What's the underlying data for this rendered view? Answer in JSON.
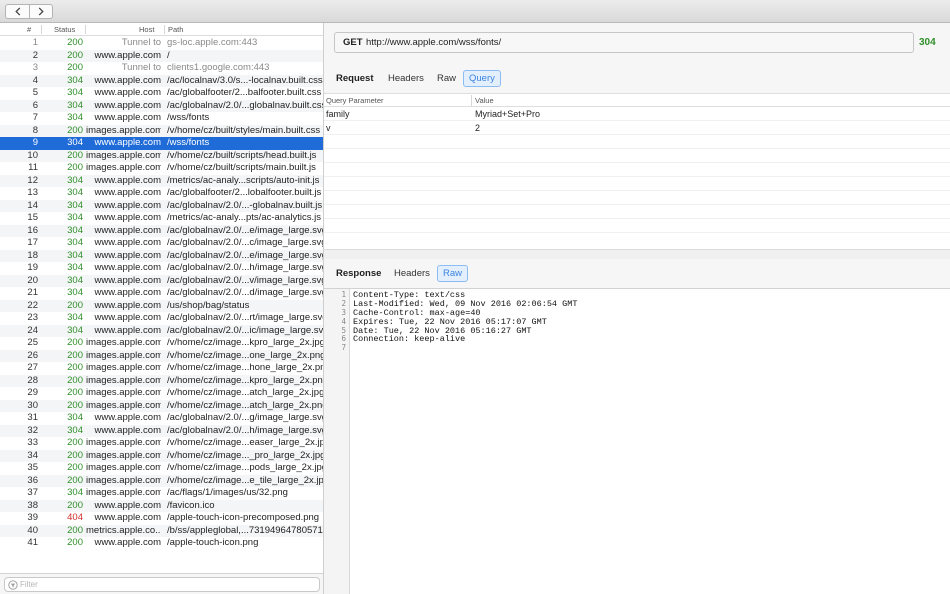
{
  "toolbar": {
    "back_icon": "chevron-left-icon",
    "forward_icon": "chevron-right-icon"
  },
  "list": {
    "headers": {
      "num": "#",
      "status": "Status",
      "host": "Host",
      "path": "Path"
    },
    "rows": [
      {
        "num": "1",
        "status": "200",
        "host": "Tunnel to",
        "path": "gs-loc.apple.com:443",
        "tunnel": true
      },
      {
        "num": "2",
        "status": "200",
        "host": "www.apple.com",
        "path": "/"
      },
      {
        "num": "3",
        "status": "200",
        "host": "Tunnel to",
        "path": "clients1.google.com:443",
        "tunnel": true
      },
      {
        "num": "4",
        "status": "304",
        "host": "www.apple.com",
        "path": "/ac/localnav/3.0/s...-localnav.built.css"
      },
      {
        "num": "5",
        "status": "304",
        "host": "www.apple.com",
        "path": "/ac/globalfooter/2...balfooter.built.css"
      },
      {
        "num": "6",
        "status": "304",
        "host": "www.apple.com",
        "path": "/ac/globalnav/2.0/...globalnav.built.css"
      },
      {
        "num": "7",
        "status": "304",
        "host": "www.apple.com",
        "path": "/wss/fonts"
      },
      {
        "num": "8",
        "status": "200",
        "host": "images.apple.com",
        "path": "/v/home/cz/built/styles/main.built.css"
      },
      {
        "num": "9",
        "status": "304",
        "host": "www.apple.com",
        "path": "/wss/fonts",
        "selected": true
      },
      {
        "num": "10",
        "status": "200",
        "host": "images.apple.com",
        "path": "/v/home/cz/built/scripts/head.built.js"
      },
      {
        "num": "11",
        "status": "200",
        "host": "images.apple.com",
        "path": "/v/home/cz/built/scripts/main.built.js"
      },
      {
        "num": "12",
        "status": "304",
        "host": "www.apple.com",
        "path": "/metrics/ac-analy...scripts/auto-init.js"
      },
      {
        "num": "13",
        "status": "304",
        "host": "www.apple.com",
        "path": "/ac/globalfooter/2...lobalfooter.built.js"
      },
      {
        "num": "14",
        "status": "304",
        "host": "www.apple.com",
        "path": "/ac/globalnav/2.0/...-globalnav.built.js"
      },
      {
        "num": "15",
        "status": "304",
        "host": "www.apple.com",
        "path": "/metrics/ac-analy...pts/ac-analytics.js"
      },
      {
        "num": "16",
        "status": "304",
        "host": "www.apple.com",
        "path": "/ac/globalnav/2.0/...e/image_large.svg"
      },
      {
        "num": "17",
        "status": "304",
        "host": "www.apple.com",
        "path": "/ac/globalnav/2.0/...c/image_large.svg"
      },
      {
        "num": "18",
        "status": "304",
        "host": "www.apple.com",
        "path": "/ac/globalnav/2.0/...e/image_large.svg"
      },
      {
        "num": "19",
        "status": "304",
        "host": "www.apple.com",
        "path": "/ac/globalnav/2.0/...h/image_large.svg"
      },
      {
        "num": "20",
        "status": "304",
        "host": "www.apple.com",
        "path": "/ac/globalnav/2.0/...v/image_large.svg"
      },
      {
        "num": "21",
        "status": "304",
        "host": "www.apple.com",
        "path": "/ac/globalnav/2.0/...d/image_large.svg"
      },
      {
        "num": "22",
        "status": "200",
        "host": "www.apple.com",
        "path": "/us/shop/bag/status"
      },
      {
        "num": "23",
        "status": "304",
        "host": "www.apple.com",
        "path": "/ac/globalnav/2.0/...rt/image_large.svg"
      },
      {
        "num": "24",
        "status": "304",
        "host": "www.apple.com",
        "path": "/ac/globalnav/2.0/...ic/image_large.svg"
      },
      {
        "num": "25",
        "status": "200",
        "host": "images.apple.com",
        "path": "/v/home/cz/image...kpro_large_2x.jpg"
      },
      {
        "num": "26",
        "status": "200",
        "host": "images.apple.com",
        "path": "/v/home/cz/image...one_large_2x.png"
      },
      {
        "num": "27",
        "status": "200",
        "host": "images.apple.com",
        "path": "/v/home/cz/image...hone_large_2x.png"
      },
      {
        "num": "28",
        "status": "200",
        "host": "images.apple.com",
        "path": "/v/home/cz/image...kpro_large_2x.png"
      },
      {
        "num": "29",
        "status": "200",
        "host": "images.apple.com",
        "path": "/v/home/cz/image...atch_large_2x.jpg"
      },
      {
        "num": "30",
        "status": "200",
        "host": "images.apple.com",
        "path": "/v/home/cz/image...atch_large_2x.png"
      },
      {
        "num": "31",
        "status": "304",
        "host": "www.apple.com",
        "path": "/ac/globalnav/2.0/...g/image_large.svg"
      },
      {
        "num": "32",
        "status": "304",
        "host": "www.apple.com",
        "path": "/ac/globalnav/2.0/...h/image_large.svg"
      },
      {
        "num": "33",
        "status": "200",
        "host": "images.apple.com",
        "path": "/v/home/cz/image...easer_large_2x.jpg"
      },
      {
        "num": "34",
        "status": "200",
        "host": "images.apple.com",
        "path": "/v/home/cz/image..._pro_large_2x.jpg"
      },
      {
        "num": "35",
        "status": "200",
        "host": "images.apple.com",
        "path": "/v/home/cz/image...pods_large_2x.jpg"
      },
      {
        "num": "36",
        "status": "200",
        "host": "images.apple.com",
        "path": "/v/home/cz/image...e_tile_large_2x.jpg"
      },
      {
        "num": "37",
        "status": "304",
        "host": "images.apple.com",
        "path": "/ac/flags/1/images/us/32.png"
      },
      {
        "num": "38",
        "status": "200",
        "host": "www.apple.com",
        "path": "/favicon.ico"
      },
      {
        "num": "39",
        "status": "404",
        "host": "www.apple.com",
        "path": "/apple-touch-icon-precomposed.png"
      },
      {
        "num": "40",
        "status": "200",
        "host": "metrics.apple.co...",
        "path": "/b/ss/appleglobal,...73194964780571"
      },
      {
        "num": "41",
        "status": "200",
        "host": "www.apple.com",
        "path": "/apple-touch-icon.png"
      }
    ],
    "filter_placeholder": "Filter",
    "filter_icon": "filter-icon"
  },
  "request": {
    "method": "GET",
    "url": "http://www.apple.com/wss/fonts/",
    "status_code": "304",
    "section_title": "Request",
    "tabs": [
      "Headers",
      "Raw",
      "Query"
    ],
    "active_tab": "Query",
    "query_headers": {
      "param": "Query Parameter",
      "value": "Value"
    },
    "query_rows": [
      {
        "param": "family",
        "value": "Myriad+Set+Pro"
      },
      {
        "param": "v",
        "value": "2"
      }
    ]
  },
  "response": {
    "section_title": "Response",
    "tabs": [
      "Headers",
      "Raw"
    ],
    "active_tab": "Raw",
    "raw_lines": [
      "Content-Type: text/css",
      "Last-Modified: Wed, 09 Nov 2016 02:06:54 GMT",
      "Cache-Control: max-age=40",
      "Expires: Tue, 22 Nov 2016 05:17:07 GMT",
      "Date: Tue, 22 Nov 2016 05:16:27 GMT",
      "Connection: keep-alive",
      ""
    ]
  },
  "colors": {
    "selection": "#1f6bd8",
    "status_ok": "#2f8f2a",
    "status_error": "#d0302c",
    "active_tab": "#3b84e0"
  }
}
